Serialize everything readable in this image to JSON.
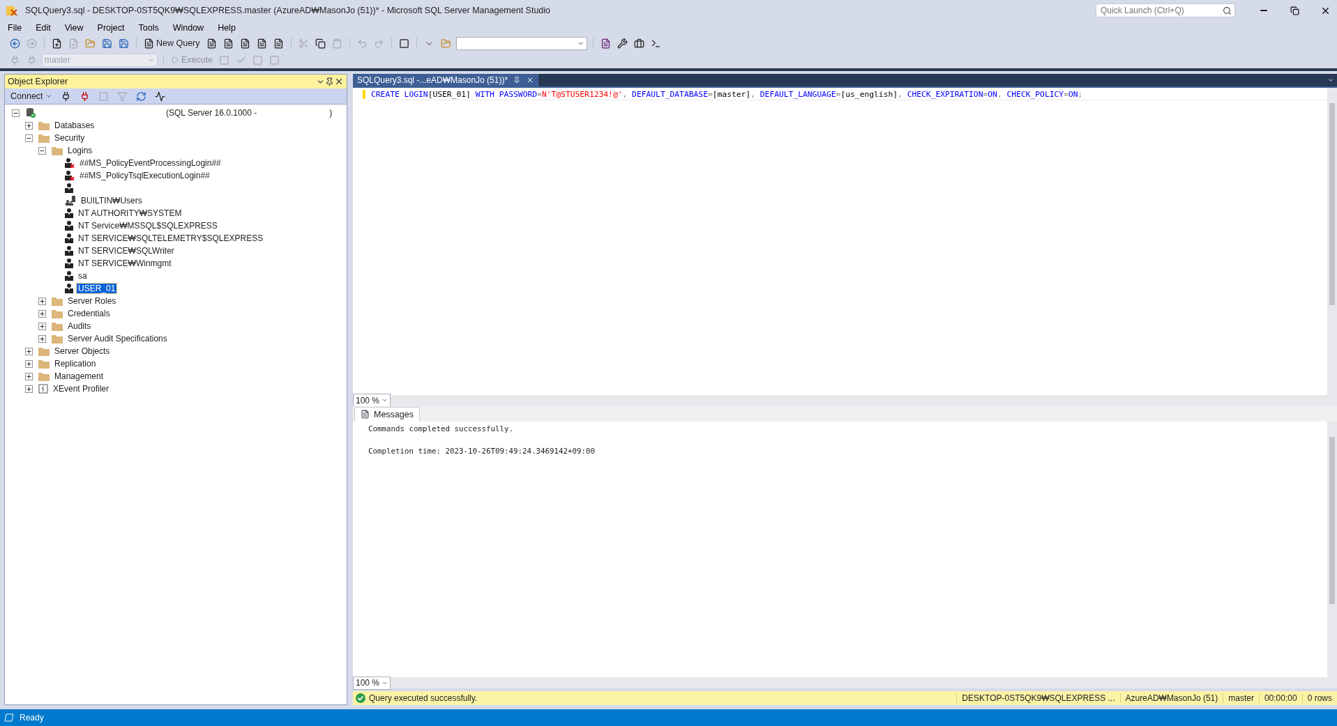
{
  "window": {
    "title": "SQLQuery3.sql - DESKTOP-0ST5QK9₩SQLEXPRESS.master (AzureAD₩MasonJo (51))* - Microsoft SQL Server Management Studio",
    "quick_launch": {
      "placeholder": "Quick Launch (Ctrl+Q)"
    }
  },
  "menu": [
    "File",
    "Edit",
    "View",
    "Project",
    "Tools",
    "Window",
    "Help"
  ],
  "toolbar": {
    "new_query": "New Query",
    "database": "master",
    "execute": {
      "label": "Execute",
      "disabled": true
    }
  },
  "object_explorer": {
    "title": "Object Explorer",
    "connect": "Connect",
    "tree": [
      {
        "kind": "server",
        "label": "(SQL Server 16.0.1000 -",
        "label_end": ")",
        "expanded": true,
        "children": [
          {
            "kind": "folder",
            "label": "Databases",
            "expanded": false
          },
          {
            "kind": "folder",
            "label": "Security",
            "expanded": true,
            "children": [
              {
                "kind": "folder",
                "label": "Logins",
                "expanded": true,
                "children": [
                  {
                    "kind": "login-disabled",
                    "label": "##MS_PolicyEventProcessingLogin##",
                    "selected": false
                  },
                  {
                    "kind": "login-disabled",
                    "label": "##MS_PolicyTsqlExecutionLogin##",
                    "selected": false
                  },
                  {
                    "kind": "login",
                    "selected": false
                  },
                  {
                    "kind": "group",
                    "label": "BUILTIN₩Users",
                    "selected": false
                  },
                  {
                    "kind": "login",
                    "label": "NT AUTHORITY₩SYSTEM",
                    "selected": false
                  },
                  {
                    "kind": "login",
                    "label": "NT Service₩MSSQL$SQLEXPRESS",
                    "selected": false
                  },
                  {
                    "kind": "login",
                    "label": "NT SERVICE₩SQLTELEMETRY$SQLEXPRESS",
                    "selected": false
                  },
                  {
                    "kind": "login",
                    "label": "NT SERVICE₩SQLWriter",
                    "selected": false
                  },
                  {
                    "kind": "login",
                    "label": "NT SERVICE₩Winmgmt",
                    "selected": false
                  },
                  {
                    "kind": "login",
                    "label": "sa",
                    "selected": false
                  },
                  {
                    "kind": "login",
                    "label": "USER_01",
                    "selected": true
                  }
                ]
              },
              {
                "kind": "folder",
                "label": "Server Roles",
                "expanded": false
              },
              {
                "kind": "folder",
                "label": "Credentials",
                "expanded": false
              },
              {
                "kind": "folder",
                "label": "Audits",
                "expanded": false
              },
              {
                "kind": "folder",
                "label": "Server Audit Specifications",
                "expanded": false
              }
            ]
          },
          {
            "kind": "folder",
            "label": "Server Objects",
            "expanded": false
          },
          {
            "kind": "folder",
            "label": "Replication",
            "expanded": false
          },
          {
            "kind": "folder",
            "label": "Management",
            "expanded": false
          },
          {
            "kind": "profiler",
            "label": "XEvent Profiler",
            "expanded": false
          }
        ]
      }
    ]
  },
  "editor": {
    "tab": {
      "label": "SQLQuery3.sql -...eAD₩MasonJo (51))*",
      "selected": true
    },
    "code": [
      {
        "kind": "keyword",
        "text": "CREATE LOGIN"
      },
      {
        "kind": "plain",
        "text": "[USER_01] "
      },
      {
        "kind": "keyword",
        "text": "WITH PASSWORD"
      },
      {
        "kind": "operator",
        "text": "="
      },
      {
        "kind": "string",
        "text": "N'T@STUSER1234!@'"
      },
      {
        "kind": "operator",
        "text": ", "
      },
      {
        "kind": "keyword",
        "text": "DEFAULT_DATABASE"
      },
      {
        "kind": "operator",
        "text": "="
      },
      {
        "kind": "plain",
        "text": "[master]"
      },
      {
        "kind": "operator",
        "text": ", "
      },
      {
        "kind": "keyword",
        "text": "DEFAULT_LANGUAGE"
      },
      {
        "kind": "operator",
        "text": "="
      },
      {
        "kind": "plain",
        "text": "[us_english]"
      },
      {
        "kind": "operator",
        "text": ", "
      },
      {
        "kind": "keyword",
        "text": "CHECK_EXPIRATION"
      },
      {
        "kind": "operator",
        "text": "="
      },
      {
        "kind": "keyword",
        "text": "ON"
      },
      {
        "kind": "operator",
        "text": ", "
      },
      {
        "kind": "keyword",
        "text": "CHECK_POLICY"
      },
      {
        "kind": "operator",
        "text": "="
      },
      {
        "kind": "keyword",
        "text": "ON"
      },
      {
        "kind": "operator",
        "text": ";"
      }
    ],
    "zoom": "100 %"
  },
  "results": {
    "tab": "Messages",
    "lines": [
      "Commands completed successfully.",
      "Completion time: 2023-10-26T09:49:24.3469142+09:00"
    ],
    "zoom": "100 %"
  },
  "query_status": {
    "message": "Query executed successfully.",
    "cells": [
      "DESKTOP-0ST5QK9₩SQLEXPRESS ...",
      "AzureAD₩MasonJo (51)",
      "master",
      "00:00:00",
      "0 rows"
    ]
  },
  "status_bar": "Ready"
}
